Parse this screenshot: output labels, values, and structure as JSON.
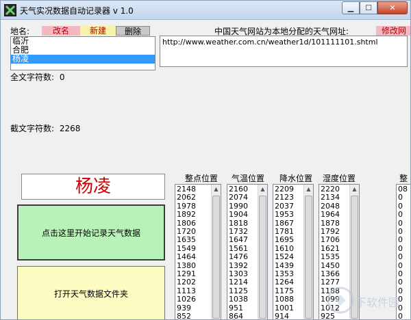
{
  "window": {
    "title": "天气实况数据自动记录器 v 1.0",
    "minimize": "▁",
    "maximize": "☐",
    "close": "✕"
  },
  "location": {
    "label": "地名:",
    "rename_button": "改名",
    "new_button": "新建",
    "delete_button": "删除",
    "items": [
      "临沂",
      "合肥",
      "杨凌"
    ],
    "selected_index": 2
  },
  "url_section": {
    "label": "中国天气网站为本地分配的天气网址:",
    "modify_button": "修改网",
    "url_value": "http://www.weather.com.cn/weather1d/101111101.shtml"
  },
  "stats": {
    "full_text_label": "全文字符数:",
    "full_text_value": "0",
    "cut_text_label": "截文字符数:",
    "cut_text_value": "2268"
  },
  "current_name": "杨凌",
  "buttons": {
    "start_record": "点击这里开始记录天气数据",
    "open_folder": "打开天气数据文件夹"
  },
  "columns": [
    {
      "header": "整点位置",
      "values": [
        "2148",
        "2062",
        "1978",
        "1892",
        "1806",
        "1720",
        "1635",
        "1549",
        "1464",
        "1380",
        "1291",
        "1202",
        "1113",
        "1026",
        "939",
        "852"
      ]
    },
    {
      "header": "气温位置",
      "values": [
        "2160",
        "2074",
        "1990",
        "1904",
        "1818",
        "1732",
        "1647",
        "1561",
        "1476",
        "1392",
        "1303",
        "1214",
        "1125",
        "1038",
        "951",
        "864"
      ]
    },
    {
      "header": "降水位置",
      "values": [
        "2209",
        "2123",
        "2037",
        "1953",
        "1867",
        "1781",
        "1695",
        "1610",
        "1524",
        "1439",
        "1353",
        "1264",
        "1175",
        "1088",
        "1001",
        "914"
      ]
    },
    {
      "header": "湿度位置",
      "values": [
        "2220",
        "2134",
        "2048",
        "1964",
        "1878",
        "1792",
        "1706",
        "1621",
        "1535",
        "1450",
        "1366",
        "1277",
        "1188",
        "1099",
        "1012",
        "925"
      ]
    },
    {
      "header": "整",
      "values": [
        "08",
        "0",
        "0",
        "0",
        "0",
        "0",
        "0",
        "0",
        "0",
        "0",
        "0",
        "0",
        "0",
        "0",
        "0",
        "0"
      ]
    }
  ],
  "colors": {
    "accent_red": "#d00000",
    "selection": "#3399ff"
  },
  "watermark": {
    "text": "下软件园"
  }
}
